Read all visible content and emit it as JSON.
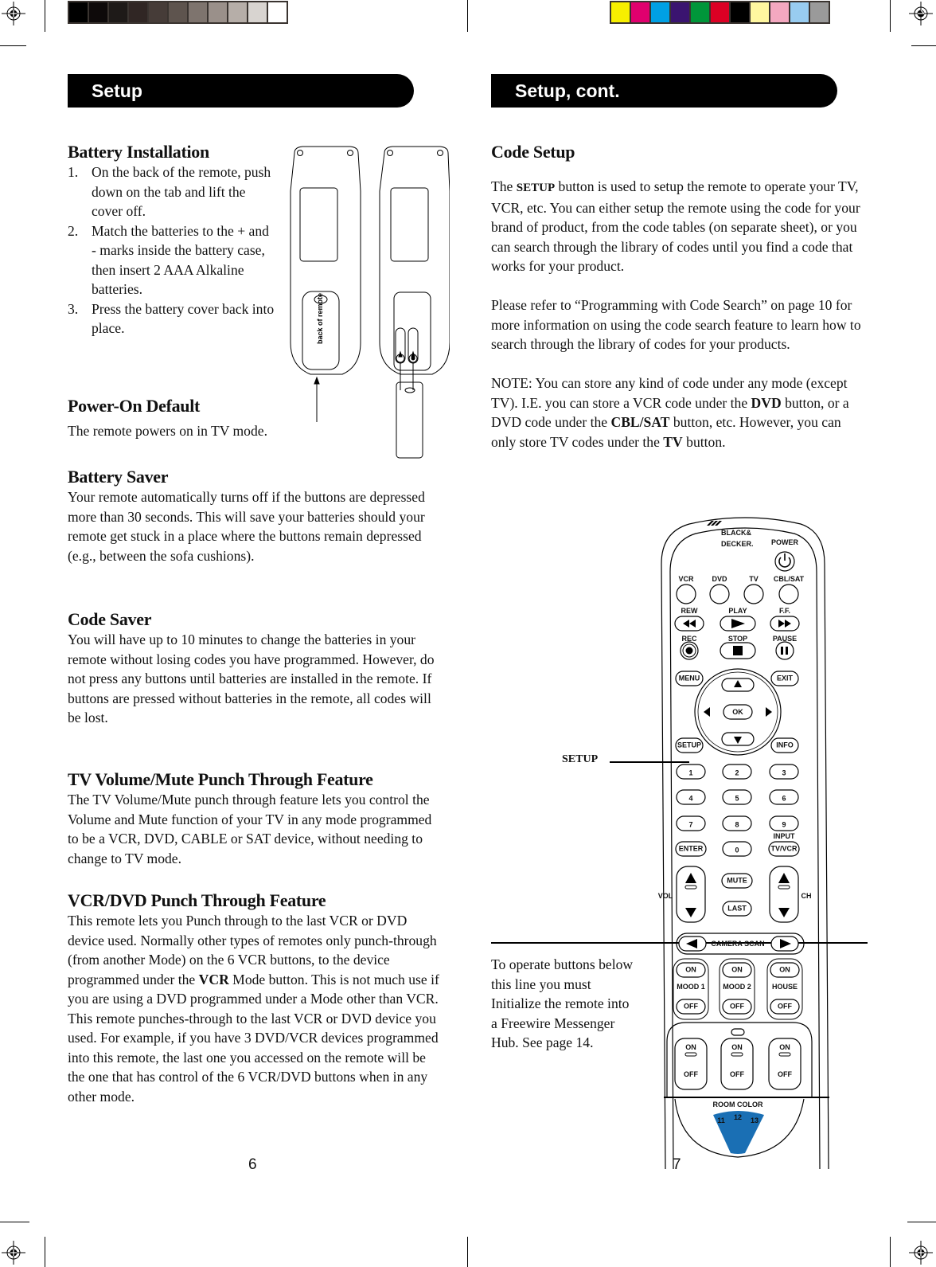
{
  "print_marks": {
    "gray_swatches": [
      "#000000",
      "#0e0a0a",
      "#1e1a18",
      "#302624",
      "#463c38",
      "#5e544e",
      "#7e746e",
      "#9a908a",
      "#b6aea8",
      "#d8d4d0",
      "#ffffff"
    ],
    "color_swatches": [
      "#f7ef00",
      "#e0006e",
      "#00a0e4",
      "#3a1470",
      "#00963a",
      "#dc0024",
      "#000000",
      "#fff7a0",
      "#f4a8c0",
      "#98ccf0",
      "#9a9a9a"
    ]
  },
  "left_page": {
    "header": "Setup",
    "page_number": "6",
    "battery_installation": {
      "title": "Battery Installation",
      "steps": [
        {
          "num": "1.",
          "text": "On the back of the remote, push down on the tab and lift the cover off."
        },
        {
          "num": "2.",
          "text": "Match the batteries to the + and - marks inside the battery case, then insert 2 AAA Alkaline batteries."
        },
        {
          "num": "3.",
          "text": "Press the battery cover back into place."
        }
      ],
      "illustration_label": "back of remote"
    },
    "power_on_default": {
      "title": "Power-On Default",
      "body": "The remote powers on in TV mode."
    },
    "battery_saver": {
      "title": "Battery Saver",
      "body": "Your remote automatically turns off if the buttons are depressed more than 30 seconds. This will save your batteries should your remote get stuck in a place where the buttons remain depressed (e.g., between the sofa cushions)."
    },
    "code_saver": {
      "title": "Code Saver",
      "body": "You will have up to 10 minutes to change the batteries in your remote without losing codes you have programmed. However, do not press any buttons until batteries are installed in the remote. If buttons are pressed without batteries in the remote, all codes will be lost."
    },
    "tv_volume_mute": {
      "title": "TV Volume/Mute Punch Through Feature",
      "body": "The TV Volume/Mute punch through feature lets you control the Volume and Mute function of your TV in any mode programmed to be a VCR, DVD, CABLE or SAT device, without needing to change to TV mode."
    },
    "vcr_dvd_punch": {
      "title": "VCR/DVD Punch Through Feature",
      "body_before": "This remote lets you Punch through to the last VCR or DVD device used. Normally other types of remotes only punch-through (from another Mode) on the 6 VCR buttons, to the device programmed under the ",
      "body_bold": "VCR",
      "body_after": " Mode button. This is not much use if you are using a DVD programmed under a Mode other than VCR. This remote punches-through to the last VCR or DVD device you used. For example, if you have 3 DVD/VCR devices programmed into this remote, the last one you accessed on the remote will be the one that has control of the 6 VCR/DVD buttons when in any other mode."
    }
  },
  "right_page": {
    "header": "Setup, cont.",
    "page_number": "7",
    "code_setup": {
      "title": "Code Setup",
      "p1_before": "The ",
      "p1_setup": "SETUP",
      "p1_after": " button is used to setup the remote to operate your TV, VCR, etc. You can either setup the remote using the code for your brand of product, from the code tables (on separate sheet), or you can search through the library of codes until you find a code that works for your product.",
      "p2": "Please refer to “Programming with Code Search” on page 10 for more information on using the code search feature to learn how to search through the library of codes for your  products.",
      "note_1": "NOTE: You can store any kind of code under any mode (except TV). I.E. you can store a VCR code under the ",
      "note_dvd": "DVD",
      "note_2": " button, or a DVD code under the ",
      "note_cbl": "CBL/SAT",
      "note_3": " button, etc. However, you can only store TV codes under the ",
      "note_tv": "TV",
      "note_4": " button."
    },
    "setup_callout": "SETUP",
    "initialize_note": "To operate buttons below this line you must Initialize the remote into a Freewire Messenger Hub. See page 14.",
    "remote": {
      "brand_line1": "BLACK&",
      "brand_line2": "DECKER.",
      "power": "POWER",
      "modes": [
        "VCR",
        "DVD",
        "TV",
        "CBL/SAT"
      ],
      "transport_top": [
        "REW",
        "PLAY",
        "F.F."
      ],
      "transport_bottom": [
        "REC",
        "STOP",
        "PAUSE"
      ],
      "menu": "MENU",
      "exit": "EXIT",
      "ok": "OK",
      "setup": "SETUP",
      "info": "INFO",
      "digits": [
        "1",
        "2",
        "3",
        "4",
        "5",
        "6",
        "7",
        "8",
        "9"
      ],
      "enter": "ENTER",
      "zero": "0",
      "input": "INPUT",
      "tvvcr": "TV/VCR",
      "vol": "VOL",
      "ch": "CH",
      "mute": "MUTE",
      "last": "LAST",
      "camera_scan": "CAMERA SCAN",
      "on": "ON",
      "off": "OFF",
      "groups": [
        "MOOD 1",
        "MOOD 2",
        "HOUSE"
      ],
      "room_color": "ROOM COLOR",
      "room_numbers": [
        "11",
        "12",
        "13"
      ],
      "accent_color": "#1a6fb4"
    }
  }
}
